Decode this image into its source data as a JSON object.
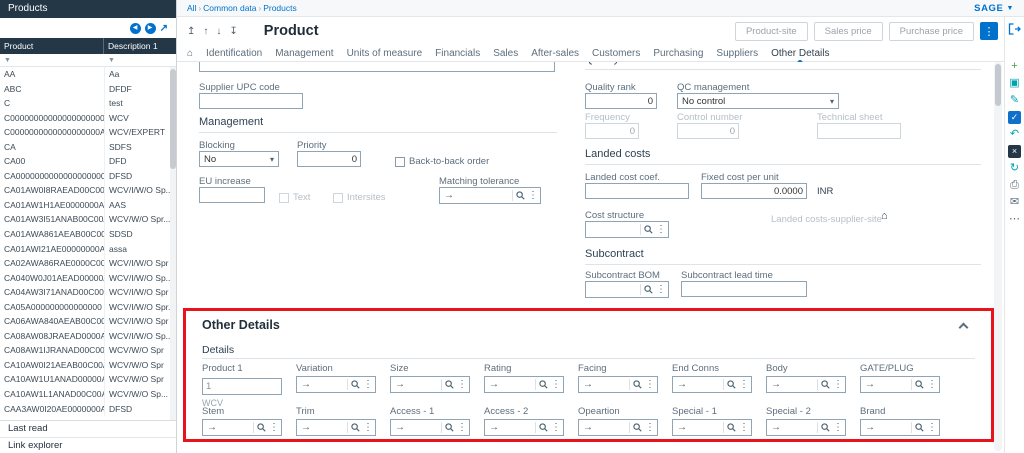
{
  "colors": {
    "accent": "#0072ce",
    "header_navy": "#233747",
    "highlight_red": "#e8131d",
    "teal": "#00a3ad",
    "green": "#43a047"
  },
  "left_panel": {
    "title": "Products",
    "toolbar_icons": [
      {
        "name": "prev-page-icon",
        "glyph": "◀",
        "type": "circle"
      },
      {
        "name": "next-page-icon",
        "glyph": "▶",
        "type": "circle"
      },
      {
        "name": "expand-panel-icon",
        "glyph": "↗",
        "type": "plain"
      }
    ],
    "table": {
      "columns": [
        "Product",
        "Description 1"
      ],
      "rows": [
        [
          "AA",
          "Aa"
        ],
        [
          "ABC",
          "DFDF"
        ],
        [
          "C",
          "test"
        ],
        [
          "C00000000000000000000",
          "WCV"
        ],
        [
          "C0000000000000000000A",
          "WCV/EXPERT"
        ],
        [
          "CA",
          "SDFS"
        ],
        [
          "CA00",
          "DFD"
        ],
        [
          "CA0000000000000000000",
          "DFSD"
        ],
        [
          "CA01AW0I8RAEAD00C00A",
          "WCV/I/W/O Sp..."
        ],
        [
          "CA01AW1H1AE0000000A",
          "AAS"
        ],
        [
          "CA01AW3I51ANAB00C00A",
          "WCV/W/O Spr..."
        ],
        [
          "CA01AWA861AEAB00C00A",
          "SDSD"
        ],
        [
          "CA01AWI21AE00000000A",
          "assa"
        ],
        [
          "CA02AWA86RAE0000C00A",
          "WCV/I/W/O Spr"
        ],
        [
          "CA040W0J01AEAD00000A",
          "WCV/I/W/O Sp..."
        ],
        [
          "CA04AW3I71ANAD00C00A",
          "WCV/I/W/O Spr"
        ],
        [
          "CA05A000000000000000",
          "WCV/I/W/O Spr..."
        ],
        [
          "CA06AWA840AEAB00C00A",
          "WCV/I/W/O Spr"
        ],
        [
          "CA08AW08JRAEAD0000A",
          "WCV/I/W/O Sp..."
        ],
        [
          "CA08AW1IJRANAD00C00A",
          "WCV/W/O Spr"
        ],
        [
          "CA10AW0I21AEAB00C00A",
          "WCV/W/O Spr"
        ],
        [
          "CA10AW1U1ANAD00000A",
          "WCV/W/O Spr"
        ],
        [
          "CA10AW1L1ANAD00C00A",
          "WCV/W/O Sp..."
        ],
        [
          "CAA3AW0I20AE0000000A",
          "DFSD"
        ]
      ]
    },
    "footer": [
      "Last read",
      "Link explorer"
    ]
  },
  "topbar": {
    "breadcrumb": [
      "All",
      "Common data",
      "Products"
    ],
    "brand": "SAGE"
  },
  "header": {
    "record_nav": [
      {
        "name": "first-record-icon",
        "glyph": "↥"
      },
      {
        "name": "previous-record-icon",
        "glyph": "↑"
      },
      {
        "name": "next-record-icon",
        "glyph": "↓"
      },
      {
        "name": "last-record-icon",
        "glyph": "↧"
      }
    ],
    "title": "Product",
    "action_buttons": [
      "Product-site",
      "Sales price",
      "Purchase price"
    ]
  },
  "tabs": {
    "home_icon": "⌂",
    "items": [
      "Identification",
      "Management",
      "Units of measure",
      "Financials",
      "Sales",
      "After-sales",
      "Customers",
      "Purchasing",
      "Suppliers",
      "Other Details"
    ],
    "active": "Other Details"
  },
  "form": {
    "left": {
      "partial_value": "",
      "supplier_upc": {
        "label": "Supplier UPC code",
        "value": ""
      },
      "management_title": "Management",
      "blocking": {
        "label": "Blocking",
        "value": "No"
      },
      "priority": {
        "label": "Priority",
        "value": "0"
      },
      "back_to_back_label": "Back-to-back order",
      "eu_increase": {
        "label": "EU increase",
        "value": ""
      },
      "text_label": "Text",
      "intersites_label": "Intersites",
      "matching_tolerance_label": "Matching tolerance"
    },
    "right": {
      "quality_title": "Quality",
      "quality_rank": {
        "label": "Quality rank",
        "value": "0"
      },
      "qc_management": {
        "label": "QC management",
        "value": "No control"
      },
      "frequency": {
        "label": "Frequency",
        "value": "0"
      },
      "control_number": {
        "label": "Control number",
        "value": "0"
      },
      "technical_sheet_label": "Technical sheet",
      "landed_title": "Landed costs",
      "landed_cost_coef_label": "Landed cost coef.",
      "fixed_cost": {
        "label": "Fixed cost per unit",
        "value": "0.0000",
        "currency": "INR"
      },
      "cost_structure_label": "Cost structure",
      "landed_supplier_site_label": "Landed costs-supplier-site",
      "subcontract_title": "Subcontract",
      "subcontract_bom_label": "Subcontract BOM",
      "subcontract_lead_label": "Subcontract lead time"
    },
    "other_details": {
      "title": "Other Details",
      "subtitle": "Details",
      "product1": {
        "label": "Product 1",
        "value": "1",
        "hint": "WCV"
      },
      "row1": [
        "Variation",
        "Size",
        "Rating",
        "Facing",
        "End Conns",
        "Body",
        "GATE/PLUG"
      ],
      "row2": [
        "Stem",
        "Trim",
        "Access - 1",
        "Access - 2",
        "Opeartion",
        "Special - 1",
        "Special - 2",
        "Brand"
      ]
    }
  },
  "right_toolbar": {
    "icons": [
      {
        "name": "add-icon",
        "glyph": "+",
        "color": "#43a047"
      },
      {
        "name": "duplicate-icon",
        "glyph": "▣",
        "color": "#00a3ad"
      },
      {
        "name": "edit-icon",
        "glyph": "✎",
        "color": "#00a3ad"
      },
      {
        "name": "save-check-icon",
        "glyph": "✓",
        "color": "#ffffff",
        "bg": "#1070ca"
      },
      {
        "name": "revert-icon",
        "glyph": "↶",
        "color": "#00a3ad"
      },
      {
        "name": "cancel-icon",
        "glyph": "×",
        "color": "#ffffff",
        "bg": "#233747"
      },
      {
        "name": "refresh-icon",
        "glyph": "↻",
        "color": "#00a3ad"
      },
      {
        "name": "print-icon",
        "glyph": "⎙",
        "color": "#5a6b7b"
      },
      {
        "name": "message-icon",
        "glyph": "✉",
        "color": "#5a6b7b"
      },
      {
        "name": "more-icon",
        "glyph": "⋯",
        "color": "#5a6b7b"
      }
    ]
  }
}
